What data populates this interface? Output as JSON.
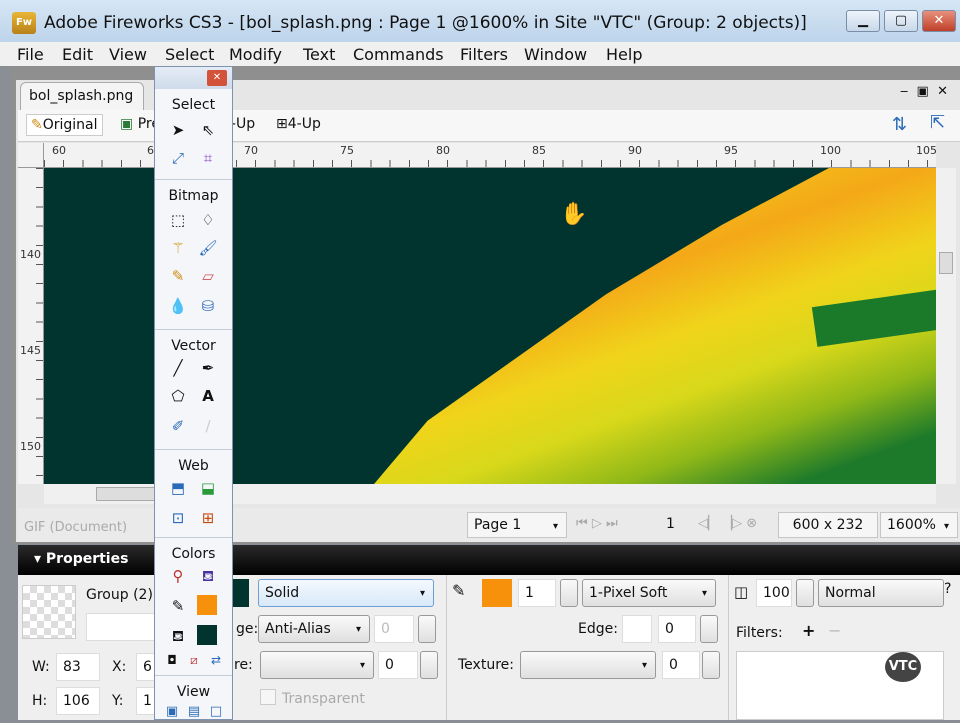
{
  "window": {
    "title": "Adobe Fireworks CS3 - [bol_splash.png : Page 1 @1600% in Site \"VTC\" (Group: 2 objects)]",
    "app_icon": "Fw"
  },
  "menu": [
    "File",
    "Edit",
    "View",
    "Select",
    "Modify",
    "Text",
    "Commands",
    "Filters",
    "Window",
    "Help"
  ],
  "document": {
    "tab": "bol_splash.png",
    "views": [
      "Original",
      "Preview",
      "2-Up",
      "4-Up"
    ],
    "hruler": [
      "60",
      "65",
      "70",
      "75",
      "80",
      "85",
      "90",
      "95",
      "100",
      "105"
    ],
    "vruler": [
      "140",
      "145",
      "150"
    ],
    "format": "GIF (Document)"
  },
  "status": {
    "page": "Page 1",
    "frame": "1",
    "size": "600 x 232",
    "zoom": "1600%"
  },
  "tools": {
    "sections": [
      "Select",
      "Bitmap",
      "Vector",
      "Web",
      "Colors",
      "View"
    ],
    "text_tool": "A"
  },
  "properties": {
    "header": "Properties",
    "object": "Group (2)",
    "w_label": "W:",
    "w": "83",
    "h_label": "H:",
    "h": "106",
    "x_label": "X:",
    "x": "6",
    "y_label": "Y:",
    "y": "1",
    "fill_type": "Solid",
    "edge_label": "ge:",
    "edge": "Anti-Alias",
    "edge_amount": "0",
    "texture_label": "re:",
    "texture_amount": "0",
    "transparent": "Transparent",
    "stroke_size": "1",
    "stroke_type": "1-Pixel Soft",
    "stroke_edge_label": "Edge:",
    "stroke_edge": "0",
    "stroke_texture_label": "Texture:",
    "stroke_texture": "0",
    "opacity": "100",
    "blend": "Normal",
    "filters_label": "Filters:",
    "filters_add": "+",
    "filters_remove": "−",
    "watermark": "VTC"
  },
  "colors": {
    "fill": "#02342f",
    "stroke": "#f7900a",
    "canvas": "#02342f"
  }
}
